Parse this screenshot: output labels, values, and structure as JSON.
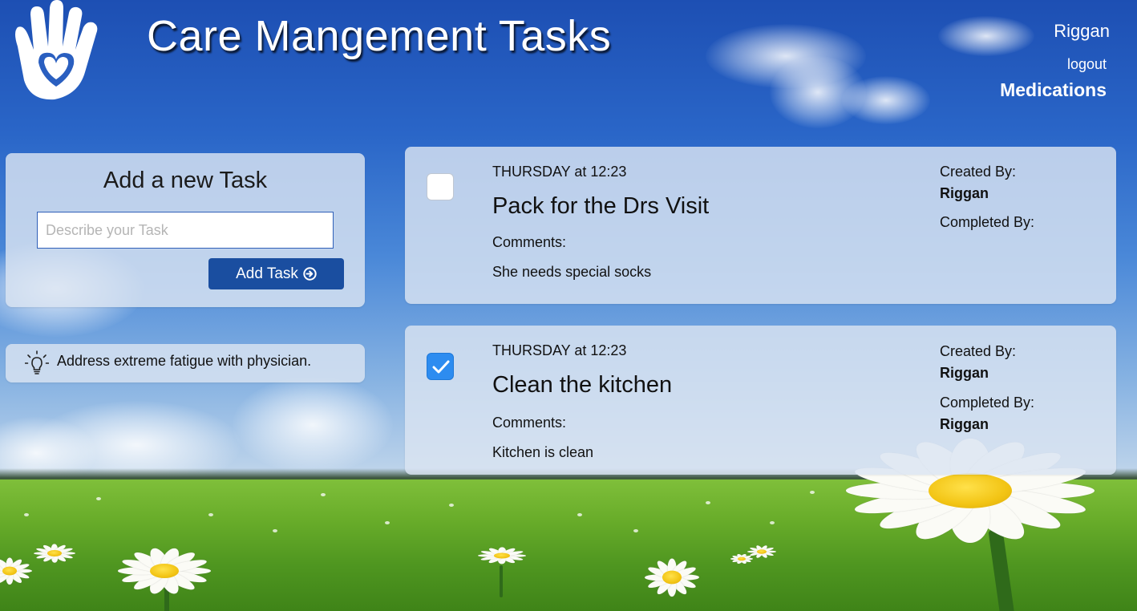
{
  "header": {
    "title": "Care Mangement Tasks",
    "user_name": "Riggan",
    "logout_label": "logout",
    "nav_medications": "Medications"
  },
  "add_task": {
    "heading": "Add a new Task",
    "input_placeholder": "Describe your Task",
    "input_value": "",
    "button_label": "Add Task",
    "button_icon": "arrow-circle-right-icon"
  },
  "tip": {
    "icon": "lightbulb-icon",
    "text": "Address extreme fatigue with physician."
  },
  "tasks": [
    {
      "checked": false,
      "date": "THURSDAY at 12:23",
      "title": "Pack for the Drs Visit",
      "comments_label": "Comments:",
      "comment": "She needs special socks",
      "created_by_label": "Created By:",
      "created_by": "Riggan",
      "completed_by_label": "Completed By:",
      "completed_by": ""
    },
    {
      "checked": true,
      "date": "THURSDAY at 12:23",
      "title": "Clean the kitchen",
      "comments_label": "Comments:",
      "comment": "Kitchen is clean",
      "created_by_label": "Created By:",
      "created_by": "Riggan",
      "completed_by_label": "Completed By:",
      "completed_by": "Riggan"
    }
  ],
  "colors": {
    "primary_button": "#1a4ea0",
    "checkbox_checked": "#2d8cf0",
    "panel_background": "#dae4f2"
  }
}
